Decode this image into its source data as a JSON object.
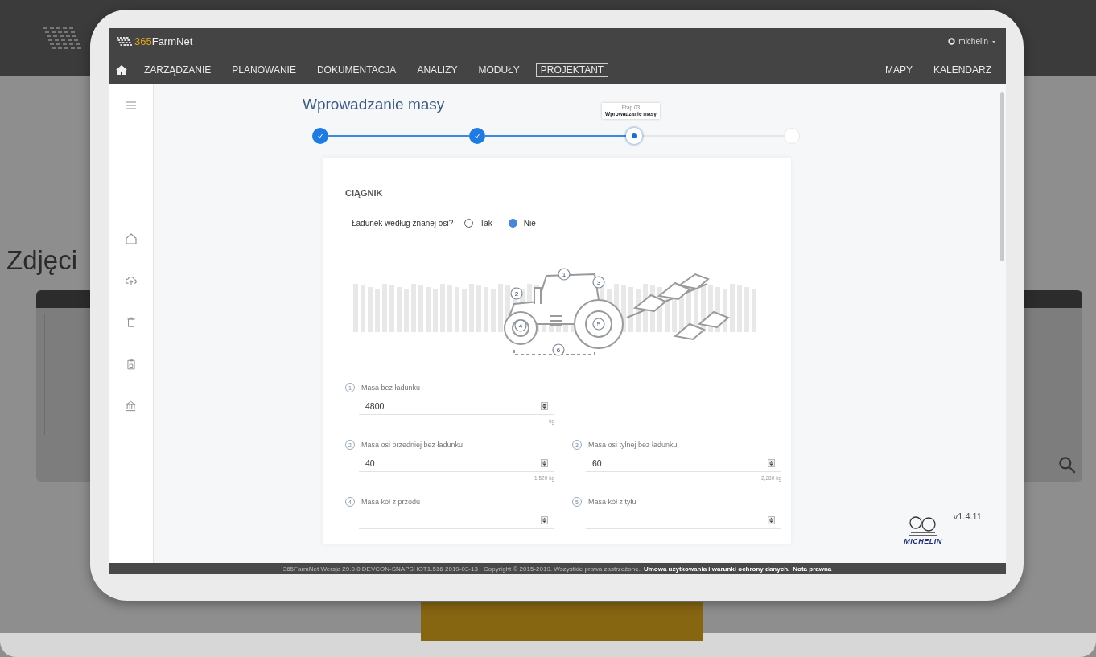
{
  "background_page": {
    "heading": "Zdjęci"
  },
  "app": {
    "brand_prefix": "365",
    "brand_name": "FarmNet",
    "user": "michelin",
    "nav": [
      {
        "label": "ZARZĄDZANIE",
        "selected": false
      },
      {
        "label": "PLANOWANIE",
        "selected": false
      },
      {
        "label": "DOKUMENTACJA",
        "selected": false
      },
      {
        "label": "ANALIZY",
        "selected": false
      },
      {
        "label": "MODUŁY",
        "selected": false
      },
      {
        "label": "PROJEKTANT",
        "selected": true
      }
    ],
    "nav_right": [
      "MAPY",
      "KALENDARZ"
    ],
    "page_title": "Wprowadzanie masy",
    "steps": [
      {
        "completed": true,
        "selected": false
      },
      {
        "completed": true,
        "selected": false
      },
      {
        "completed": false,
        "selected": true
      },
      {
        "completed": false,
        "selected": false
      }
    ],
    "step_tooltip": {
      "stage": "Etap 03",
      "name": "Wprowadzanie masy"
    },
    "section_title": "CIĄGNIK",
    "question": "Ładunek według znanej osi?",
    "options": [
      {
        "label": "Tak",
        "selected": false
      },
      {
        "label": "Nie",
        "selected": true
      }
    ],
    "diagram_numbers": [
      "1",
      "2",
      "3",
      "4",
      "5",
      "6"
    ],
    "field_rows": [
      [
        {
          "number": "1",
          "label": "Masa bez ładunku",
          "value": "4800",
          "hint": "kg"
        }
      ],
      [
        {
          "number": "2",
          "label": "Masa osi przedniej bez ładunku",
          "value": "40",
          "hint": "1,520 kg"
        },
        {
          "number": "3",
          "label": "Masa osi tylnej bez ładunku",
          "value": "60",
          "hint": "2,280 kg"
        }
      ],
      [
        {
          "number": "4",
          "label": "Masa kół z przodu"
        },
        {
          "number": "5",
          "label": "Masa kół z tyłu"
        }
      ]
    ],
    "version": "v1.4.11",
    "partner_logo": "MICHELIN",
    "footer": {
      "text": "365FarmNet Wersja 29.0.0 DEVCON-SNAPSHOT1.516 2019-03-13 · Copyright © 2015-2019. Wszystkie prawa zastrzeżone.",
      "links": [
        "Umowa użytkowania i warunki ochrony danych.",
        "Nota prawna"
      ]
    }
  }
}
